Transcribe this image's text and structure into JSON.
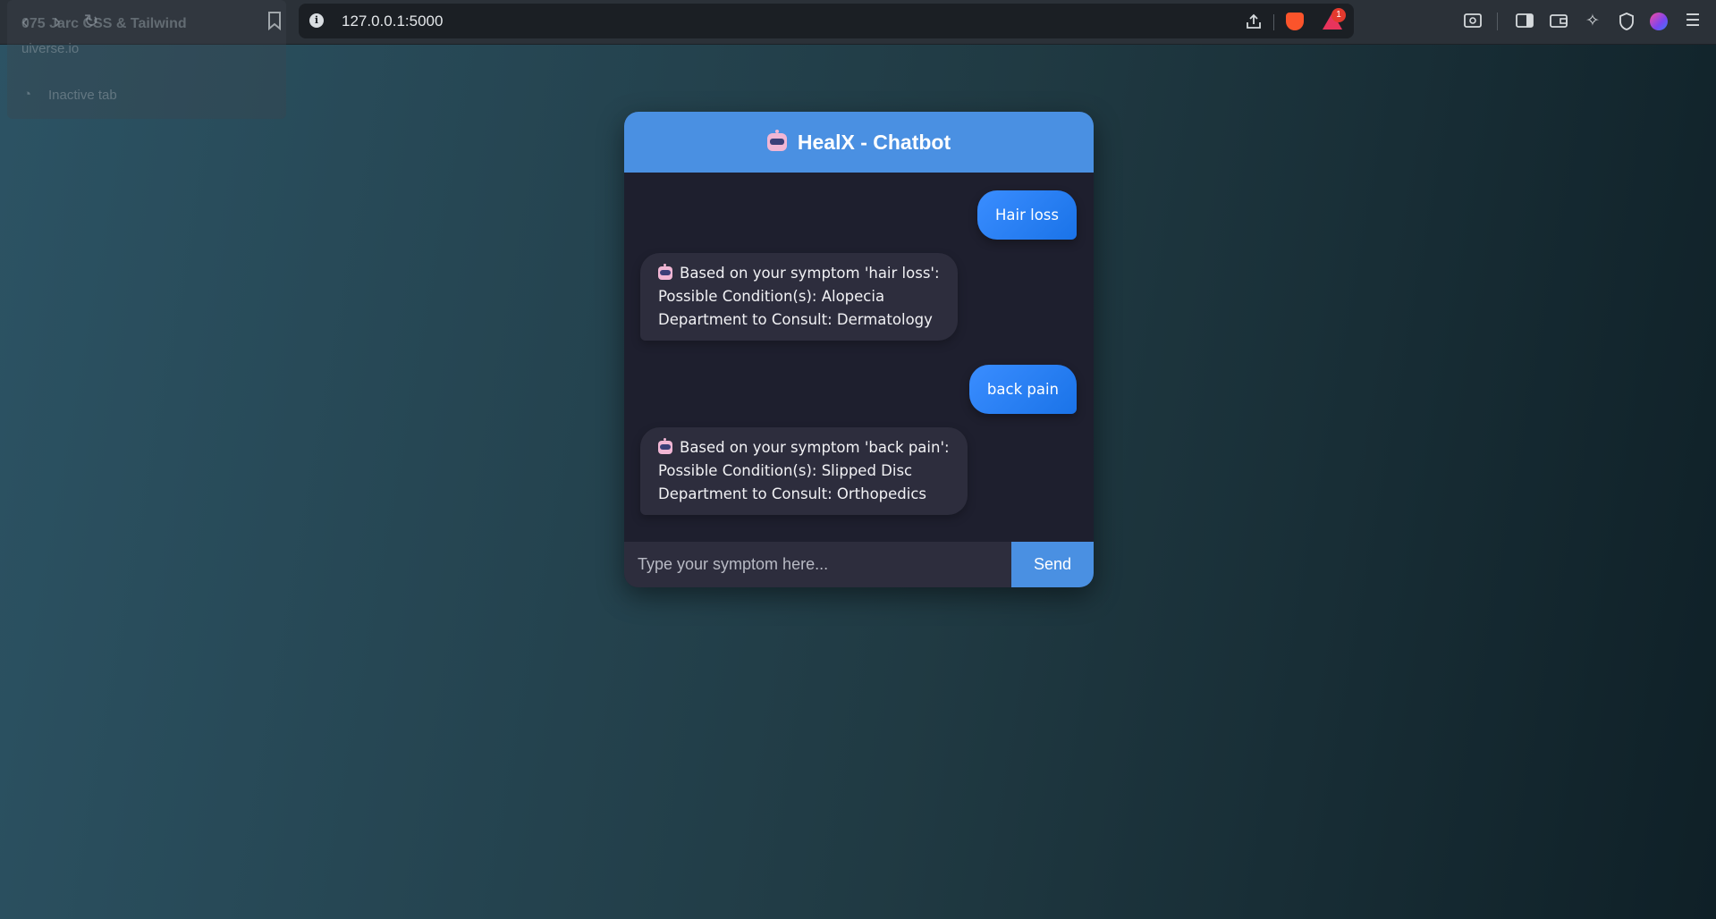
{
  "browser": {
    "url": "127.0.0.1:5000",
    "rewards_badge": "1",
    "tooltip": {
      "title": "075 Jarc CSS & Tailwind",
      "host": "uiverse.io",
      "status": "Inactive tab"
    },
    "icons": [
      "back-icon",
      "forward-icon",
      "reload-icon",
      "bookmark-icon",
      "site-info-icon",
      "share-icon",
      "brave-shields-icon",
      "brave-rewards-icon",
      "screenshot-icon",
      "sidebar-icon",
      "wallet-icon",
      "leo-ai-icon",
      "vpn-icon",
      "profile-icon",
      "menu-icon"
    ]
  },
  "chat": {
    "title": "HealX - Chatbot",
    "messages": [
      {
        "role": "user",
        "text": "Hair loss"
      },
      {
        "role": "bot",
        "lines": [
          "Based on your symptom 'hair loss':",
          "Possible Condition(s): Alopecia",
          "Department to Consult: Dermatology"
        ]
      },
      {
        "role": "user",
        "text": "back pain"
      },
      {
        "role": "bot",
        "lines": [
          "Based on your symptom 'back pain':",
          "Possible Condition(s): Slipped Disc",
          "Department to Consult: Orthopedics"
        ]
      }
    ],
    "input_placeholder": "Type your symptom here...",
    "input_value": "",
    "send_label": "Send"
  },
  "colors": {
    "header": "#4a90e2",
    "user_bubble": "#1a73e8",
    "bot_bubble": "#2d2d3d",
    "card_bg": "#1e1f2e"
  }
}
